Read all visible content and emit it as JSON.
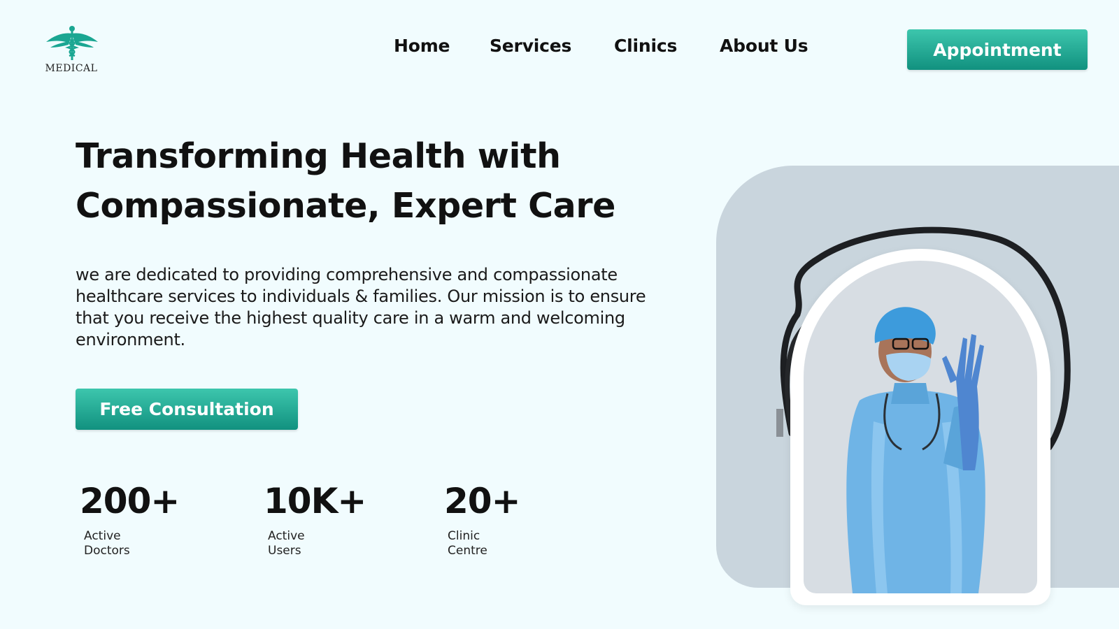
{
  "brand": {
    "logo_text": "MEDICAL",
    "logo_icon": "caduceus-icon",
    "accent": "#1aa692"
  },
  "nav": {
    "home": "Home",
    "services": "Services",
    "clinics": "Clinics",
    "about": "About Us",
    "appointment": "Appointment"
  },
  "hero": {
    "headline_line1": "Transforming Health with",
    "headline_line2": "Compassionate, Expert Care",
    "description": "we are dedicated to providing comprehensive and compassionate healthcare services to individuals & families. Our mission is to ensure that you receive the highest quality care in a warm and welcoming environment.",
    "cta": "Free Consultation"
  },
  "stats": [
    {
      "value": "200+",
      "label_line1": "Active",
      "label_line2": "Doctors"
    },
    {
      "value": "10K+",
      "label_line1": "Active",
      "label_line2": "Users"
    },
    {
      "value": "20+",
      "label_line1": "Clinic",
      "label_line2": "Centre"
    }
  ],
  "colors": {
    "page_bg": "#f1fcfe",
    "button_top": "#3dc6ad",
    "button_bottom": "#11917f",
    "hero_panel": "#c9d5dd",
    "gown": "#6fb4e6"
  }
}
